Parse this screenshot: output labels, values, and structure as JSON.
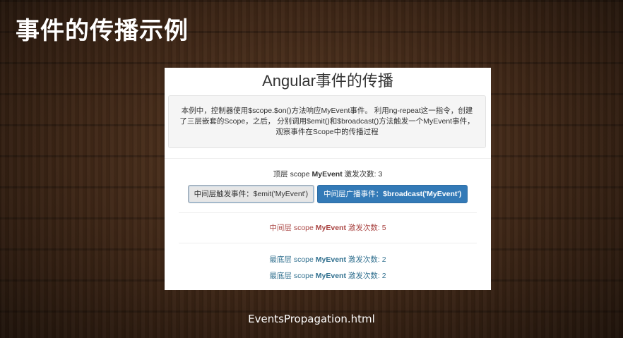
{
  "slide": {
    "title": "事件的传播示例",
    "filename": "EventsPropagation.html"
  },
  "app": {
    "heading": "Angular事件的传播",
    "description": {
      "line1": "本例中，控制器使用$scope.$on()方法响应MyEvent事件。 利用ng-repeat这一指令，创建",
      "line2": "了三层嵌套的Scope，之后， 分别调用$emit()和$broadcast()方法触发一个MyEvent事件，",
      "line3": "观察事件在Scope中的传播过程"
    },
    "top_scope": {
      "prefix": "顶层 scope ",
      "event": "MyEvent",
      "suffix": " 激发次数: 3"
    },
    "buttons": {
      "emit": {
        "label": "中间层触发事件：$emit('MyEvent')"
      },
      "broadcast": {
        "prefix": "中间层广播事件：",
        "code": "$broadcast('MyEvent')"
      }
    },
    "middle_scope": {
      "prefix": "中间层 scope ",
      "event": "MyEvent",
      "suffix": " 激发次数: 5"
    },
    "bottom_scopes": [
      {
        "prefix": "最底层 scope ",
        "event": "MyEvent",
        "suffix": " 激发次数: 2"
      },
      {
        "prefix": "最底层 scope ",
        "event": "MyEvent",
        "suffix": " 激发次数: 2"
      }
    ]
  },
  "colors": {
    "primary_button": "#337ab7",
    "middle_scope_text": "#a94442",
    "bottom_scope_text": "#31708f",
    "background": "#3d2616"
  }
}
